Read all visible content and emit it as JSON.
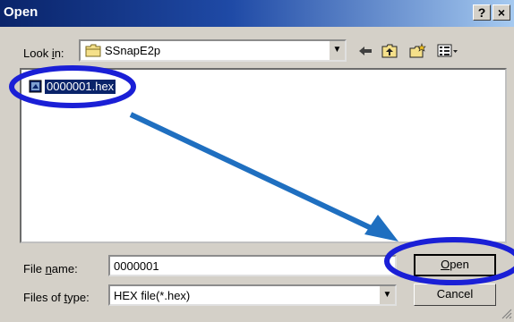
{
  "dialog": {
    "title": "Open",
    "help_label": "?",
    "close_label": "×"
  },
  "lookin": {
    "label_prefix": "Look ",
    "label_hotkey": "i",
    "label_suffix": "n:",
    "value": "SSnapE2p"
  },
  "files": [
    {
      "name": "0000001.hex",
      "selected": true
    }
  ],
  "filename": {
    "label_prefix": "File ",
    "label_hotkey": "n",
    "label_suffix": "ame:",
    "value": "0000001"
  },
  "filetype": {
    "label_prefix": "Files of ",
    "label_hotkey": "t",
    "label_suffix": "ype:",
    "value": "HEX file(*.hex)"
  },
  "buttons": {
    "open_hotkey": "O",
    "open_rest": "pen",
    "cancel": "Cancel"
  },
  "annotations": {
    "circle_color": "#1a1fd6",
    "arrow_color": "#1f6fc0"
  }
}
